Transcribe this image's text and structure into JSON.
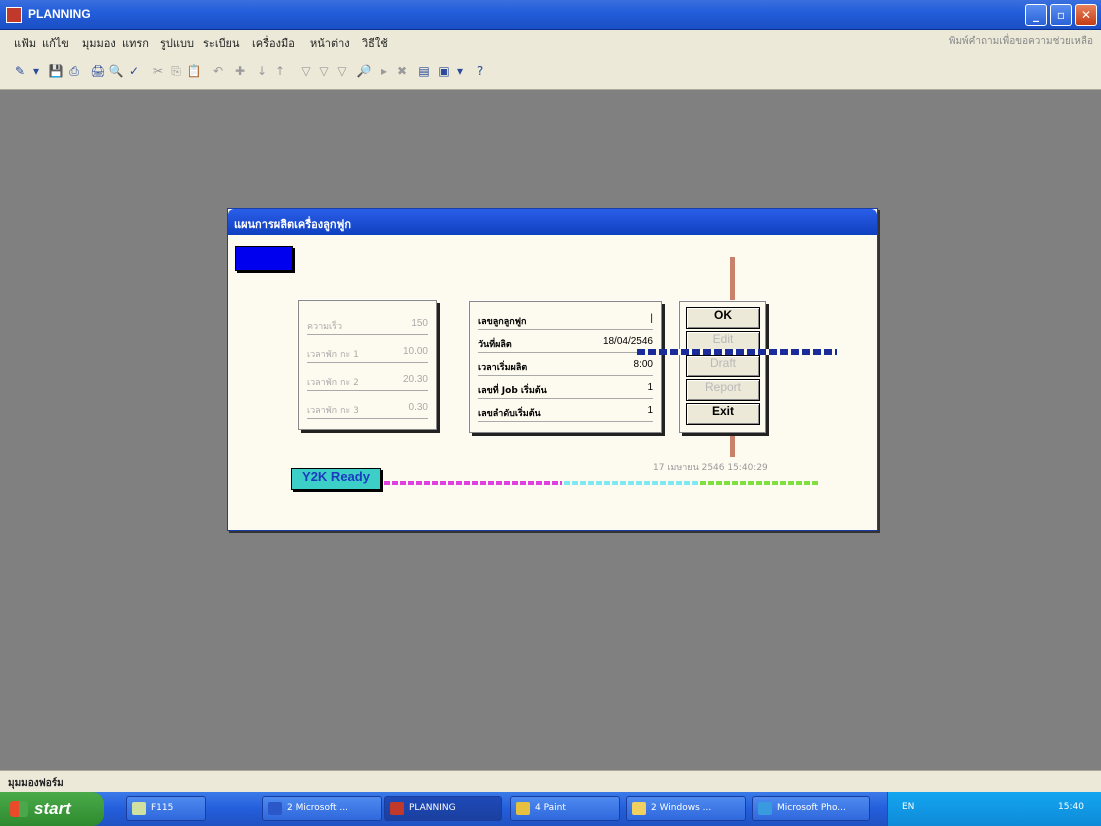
{
  "window": {
    "title": "PLANNING",
    "buttons": [
      "_",
      "▫",
      "✕"
    ]
  },
  "menu": {
    "items": [
      "แฟ้ม",
      "แก้ไข",
      "มุมมอง",
      "แทรก",
      "รูปแบบ",
      "ระเบียน",
      "เครื่องมือ",
      "หน้าต่าง",
      "วิธีใช้"
    ],
    "ask": "พิมพ์คำถามเพื่อขอความช่วยเหลือ"
  },
  "toolbar": {
    "icons": [
      "✎",
      "▾",
      "💾",
      "⎙",
      "🖨",
      "🔍",
      "✓",
      "✂",
      "⎘",
      "📋",
      "↶",
      "✚",
      "↓",
      "↑",
      "▽",
      "▽",
      "▽",
      "🔎",
      "▸",
      "✖",
      "▤",
      "▣",
      "▾",
      "?"
    ]
  },
  "dialog": {
    "title": "แผนการผลิตเครื่องลูกฟูก",
    "left_panel": [
      {
        "label": "ความเร็ว",
        "value": "150"
      },
      {
        "label": "เวลาพัก กะ 1",
        "value": "10.00"
      },
      {
        "label": "เวลาพัก กะ 2",
        "value": "20.30"
      },
      {
        "label": "เวลาพัก กะ 3",
        "value": "0.30"
      }
    ],
    "right_panel": [
      {
        "label": "เลขลูกลูกฟูก",
        "value": "|"
      },
      {
        "label": "วันที่ผลิต",
        "value": "18/04/2546"
      },
      {
        "label": "เวลาเริ่มผลิต",
        "value": "8:00"
      },
      {
        "label": "เลขที่ Job เริ่มต้น",
        "value": "1"
      },
      {
        "label": "เลขลำดับเริ่มต้น",
        "value": "1"
      }
    ],
    "buttons": {
      "ok": "OK",
      "edit": "Edit",
      "draft": "Draft",
      "report": "Report",
      "exit": "Exit"
    },
    "y2k": "Y2K Ready",
    "datetime": "17 เมษายน 2546 15:40:29",
    "colors": {
      "stripe_magenta": "#e040e0",
      "stripe_cyan": "#80e8f0",
      "stripe_green": "#80e040"
    }
  },
  "status": {
    "text": "มุมมองฟอร์ม"
  },
  "taskbar": {
    "start": "start",
    "items": [
      {
        "label": "F115",
        "color": "#cfe0a0"
      },
      {
        "label": "2 Microsoft ...",
        "color": "#2a58c8"
      },
      {
        "label": "PLANNING",
        "color": "#c0392b"
      },
      {
        "label": "4 Paint",
        "color": "#e8c040"
      },
      {
        "label": "2 Windows ...",
        "color": "#f0d060"
      },
      {
        "label": "Microsoft Pho...",
        "color": "#3a9ae0"
      }
    ],
    "tray": {
      "lang": "EN",
      "time": "15:40"
    }
  }
}
